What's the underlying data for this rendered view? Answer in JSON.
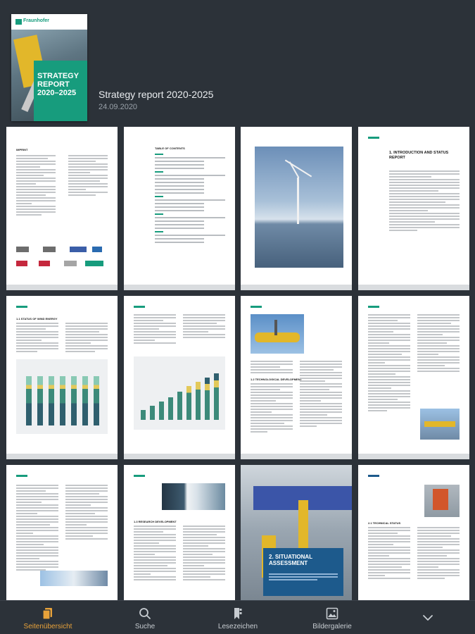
{
  "document": {
    "cover": {
      "brand": "Fraunhofer",
      "title": "STRATEGY REPORT 2020–2025"
    },
    "title": "Strategy report 2020-2025",
    "date": "24.09.2020"
  },
  "pages": [
    {
      "heading": "IMPRINT"
    },
    {
      "heading": "TABLE OF CONTENTS"
    },
    {
      "heading": ""
    },
    {
      "heading": "1. INTRODUCTION AND STATUS REPORT"
    },
    {
      "heading": "1.1 STATUS OF WIND ENERGY"
    },
    {
      "heading": ""
    },
    {
      "heading": "1.2 TECHNOLOGICAL DEVELOPMENT"
    },
    {
      "heading": ""
    },
    {
      "heading": ""
    },
    {
      "heading": "1.3 RESEARCH DEVELOPMENT"
    },
    {
      "heading": "2. SITUATIONAL ASSESSMENT"
    },
    {
      "heading": "2.1 TECHNICAL STATUS"
    }
  ],
  "tabs": [
    {
      "label": "Seitenübersicht",
      "icon": "pages-icon",
      "active": true
    },
    {
      "label": "Suche",
      "icon": "search-icon",
      "active": false
    },
    {
      "label": "Lesezeichen",
      "icon": "bookmark-icon",
      "active": false
    },
    {
      "label": "Bildergalerie",
      "icon": "gallery-icon",
      "active": false
    },
    {
      "label": "",
      "icon": "chevron-down-icon",
      "active": false
    }
  ],
  "colors": {
    "background": "#2c3239",
    "accent_green": "#179c7d",
    "active_tab": "#e8a23a"
  }
}
